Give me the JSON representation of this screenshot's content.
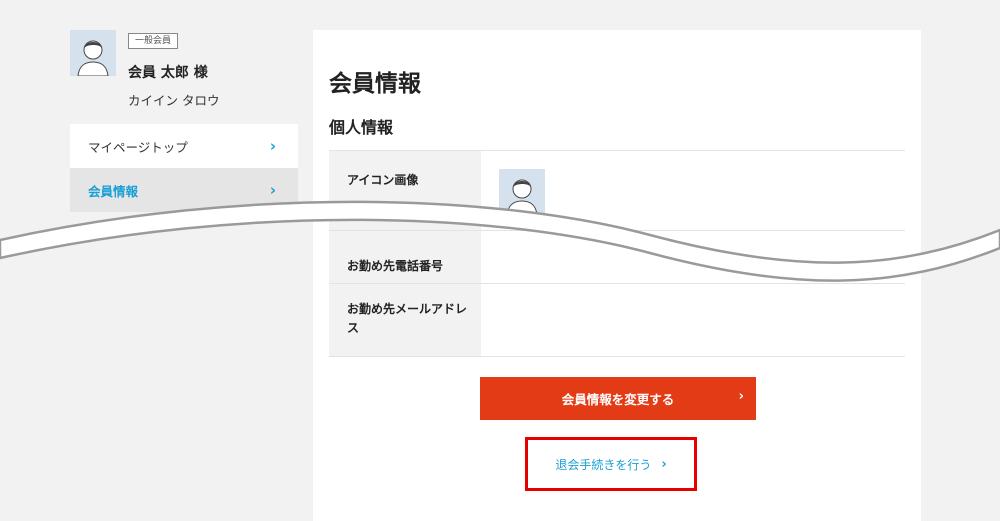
{
  "profile": {
    "badge": "一般会員",
    "name": "会員 太郎 様",
    "kana": "カイイン タロウ"
  },
  "sidebar": {
    "items": [
      {
        "label": "マイページトップ",
        "chevron": "›"
      },
      {
        "label": "会員情報",
        "chevron": "›",
        "active": true
      }
    ]
  },
  "main": {
    "title": "会員情報",
    "section_title": "個人情報",
    "rows": [
      {
        "label": "アイコン画像"
      },
      {
        "label": "お勤め先電話番号"
      },
      {
        "label": "お勤め先メールアドレス"
      }
    ],
    "edit_button": "会員情報を変更する",
    "withdraw_link": "退会手続きを行う",
    "arrow": "›"
  },
  "colors": {
    "accent_blue": "#1a9fd6",
    "cta_orange": "#e23b16",
    "highlight_red": "#e60000"
  }
}
